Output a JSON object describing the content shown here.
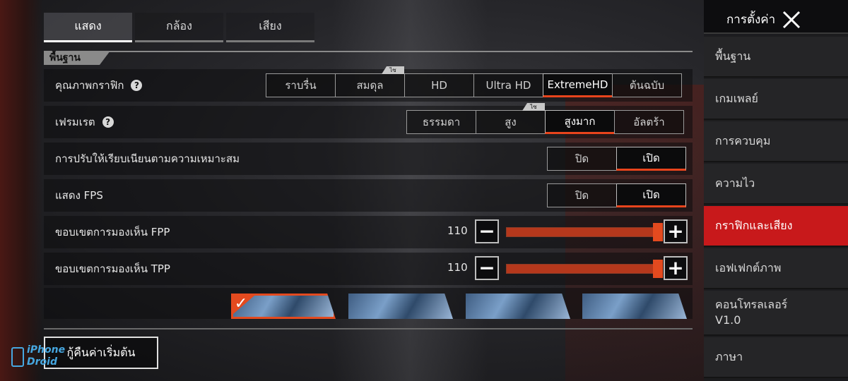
{
  "tabs": [
    {
      "label": "แสดง",
      "active": true
    },
    {
      "label": "กล้อง",
      "active": false
    },
    {
      "label": "เสียง",
      "active": false
    }
  ],
  "section": {
    "title": "พื้นฐาน"
  },
  "graphics_quality": {
    "label": "คุณภาพกราฟิก",
    "options": [
      "ราบรื่น",
      "สมดุล",
      "HD",
      "Ultra HD",
      "ExtremeHD",
      "ต้นฉบับ"
    ],
    "selected": "ExtremeHD",
    "tag": "ไซ"
  },
  "frame_rate": {
    "label": "เฟรมเรต",
    "options": [
      "ธรรมดา",
      "สูง",
      "สูงมาก",
      "อัลตร้า"
    ],
    "selected": "สูงมาก",
    "tag": "ไซ"
  },
  "adaptive_smoothing": {
    "label": "การปรับให้เรียบเนียนตามความเหมาะสม",
    "off": "ปิด",
    "on": "เปิด",
    "selected": "เปิด"
  },
  "show_fps": {
    "label": "แสดง FPS",
    "off": "ปิด",
    "on": "เปิด",
    "selected": "เปิด"
  },
  "fov_fpp": {
    "label": "ขอบเขตการมองเห็น FPP",
    "value": "110",
    "fraction": 1.0
  },
  "fov_tpp": {
    "label": "ขอบเขตการมองเห็น TPP",
    "value": "110",
    "fraction": 1.0
  },
  "crosshair_styles": {
    "selected_index": 0,
    "count": 4
  },
  "reset_button": "กู้คืนค่าเริ่มต้น",
  "watermark": {
    "line1": "iPhone",
    "line2": "Droid"
  },
  "sidebar": {
    "title": "การตั้งค่า",
    "items": [
      {
        "label": "พื้นฐาน"
      },
      {
        "label": "เกมเพลย์"
      },
      {
        "label": "การควบคุม"
      },
      {
        "label": "ความไว"
      },
      {
        "label": "กราฟิกและเสียง",
        "active": true
      },
      {
        "label": "เอฟเฟกต์ภาพ"
      },
      {
        "label": "คอนโทรลเลอร์",
        "line2": "V1.0"
      },
      {
        "label": "ภาษา"
      }
    ]
  },
  "colors": {
    "accent": "#e34a1f",
    "active_sidebar": "#c8191b"
  }
}
